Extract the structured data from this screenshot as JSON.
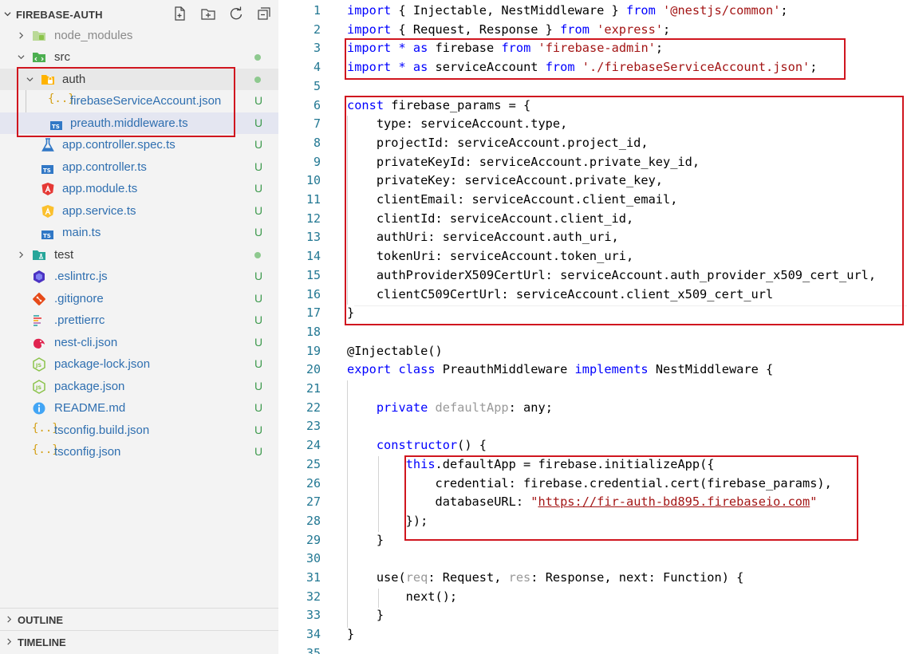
{
  "explorer": {
    "title": "FIREBASE-AUTH",
    "actions": [
      "new-file-icon",
      "new-folder-icon",
      "refresh-icon",
      "collapse-all-icon"
    ],
    "items": [
      {
        "label": "node_modules",
        "depth": 0,
        "kind": "folder",
        "expanded": false,
        "status": "",
        "icon": "node-modules-folder-icon"
      },
      {
        "label": "src",
        "depth": 0,
        "kind": "folder",
        "expanded": true,
        "status": "dot",
        "icon": "src-folder-icon"
      },
      {
        "label": "auth",
        "depth": 1,
        "kind": "folder",
        "expanded": true,
        "status": "dot",
        "icon": "auth-folder-icon"
      },
      {
        "label": "firebaseServiceAccount.json",
        "depth": 2,
        "kind": "file",
        "status": "U",
        "icon": "json-file-icon"
      },
      {
        "label": "preauth.middleware.ts",
        "depth": 2,
        "kind": "file",
        "status": "U",
        "icon": "typescript-file-icon",
        "selected": true
      },
      {
        "label": "app.controller.spec.ts",
        "depth": 1,
        "kind": "file",
        "status": "U",
        "icon": "test-flask-icon"
      },
      {
        "label": "app.controller.ts",
        "depth": 1,
        "kind": "file",
        "status": "U",
        "icon": "typescript-file-icon"
      },
      {
        "label": "app.module.ts",
        "depth": 1,
        "kind": "file",
        "status": "U",
        "icon": "angular-icon"
      },
      {
        "label": "app.service.ts",
        "depth": 1,
        "kind": "file",
        "status": "U",
        "icon": "service-icon"
      },
      {
        "label": "main.ts",
        "depth": 1,
        "kind": "file",
        "status": "U",
        "icon": "typescript-file-icon"
      },
      {
        "label": "test",
        "depth": 0,
        "kind": "folder",
        "expanded": false,
        "status": "dot",
        "icon": "test-folder-icon"
      },
      {
        "label": ".eslintrc.js",
        "depth": 0,
        "kind": "file",
        "status": "U",
        "icon": "eslint-icon"
      },
      {
        "label": ".gitignore",
        "depth": 0,
        "kind": "file",
        "status": "U",
        "icon": "git-icon"
      },
      {
        "label": ".prettierrc",
        "depth": 0,
        "kind": "file",
        "status": "U",
        "icon": "prettier-icon"
      },
      {
        "label": "nest-cli.json",
        "depth": 0,
        "kind": "file",
        "status": "U",
        "icon": "nest-icon"
      },
      {
        "label": "package-lock.json",
        "depth": 0,
        "kind": "file",
        "status": "U",
        "icon": "nodejs-icon"
      },
      {
        "label": "package.json",
        "depth": 0,
        "kind": "file",
        "status": "U",
        "icon": "nodejs-icon"
      },
      {
        "label": "README.md",
        "depth": 0,
        "kind": "file",
        "status": "U",
        "icon": "info-icon"
      },
      {
        "label": "tsconfig.build.json",
        "depth": 0,
        "kind": "file",
        "status": "U",
        "icon": "json-file-icon"
      },
      {
        "label": "tsconfig.json",
        "depth": 0,
        "kind": "file",
        "status": "U",
        "icon": "json-file-icon"
      }
    ],
    "outline_label": "OUTLINE",
    "timeline_label": "TIMELINE"
  },
  "editor": {
    "line_numbers": [
      "1",
      "2",
      "3",
      "4",
      "5",
      "6",
      "7",
      "8",
      "9",
      "10",
      "11",
      "12",
      "13",
      "14",
      "15",
      "16",
      "17",
      "18",
      "19",
      "20",
      "21",
      "22",
      "23",
      "24",
      "25",
      "26",
      "27",
      "28",
      "29",
      "30",
      "31",
      "32",
      "33",
      "34",
      "35"
    ],
    "lines": [
      [
        [
          "kw",
          "import"
        ],
        [
          "plain",
          " { Injectable, NestMiddleware } "
        ],
        [
          "kw",
          "from"
        ],
        [
          "plain",
          " "
        ],
        [
          "str",
          "'@nestjs/common'"
        ],
        [
          "plain",
          ";"
        ]
      ],
      [
        [
          "kw",
          "import"
        ],
        [
          "plain",
          " { Request, Response } "
        ],
        [
          "kw",
          "from"
        ],
        [
          "plain",
          " "
        ],
        [
          "str",
          "'express'"
        ],
        [
          "plain",
          ";"
        ]
      ],
      [
        [
          "kw",
          "import"
        ],
        [
          "plain",
          " "
        ],
        [
          "kw",
          "*"
        ],
        [
          "plain",
          " "
        ],
        [
          "kw",
          "as"
        ],
        [
          "plain",
          " firebase "
        ],
        [
          "kw",
          "from"
        ],
        [
          "plain",
          " "
        ],
        [
          "str",
          "'firebase-admin'"
        ],
        [
          "plain",
          ";"
        ]
      ],
      [
        [
          "kw",
          "import"
        ],
        [
          "plain",
          " "
        ],
        [
          "kw",
          "*"
        ],
        [
          "plain",
          " "
        ],
        [
          "kw",
          "as"
        ],
        [
          "plain",
          " serviceAccount "
        ],
        [
          "kw",
          "from"
        ],
        [
          "plain",
          " "
        ],
        [
          "str",
          "'./firebaseServiceAccount.json'"
        ],
        [
          "plain",
          ";"
        ]
      ],
      [],
      [
        [
          "kw",
          "const"
        ],
        [
          "plain",
          " firebase_params = {"
        ]
      ],
      [
        [
          "plain",
          "    type: serviceAccount.type,"
        ]
      ],
      [
        [
          "plain",
          "    projectId: serviceAccount.project_id,"
        ]
      ],
      [
        [
          "plain",
          "    privateKeyId: serviceAccount.private_key_id,"
        ]
      ],
      [
        [
          "plain",
          "    privateKey: serviceAccount.private_key,"
        ]
      ],
      [
        [
          "plain",
          "    clientEmail: serviceAccount.client_email,"
        ]
      ],
      [
        [
          "plain",
          "    clientId: serviceAccount.client_id,"
        ]
      ],
      [
        [
          "plain",
          "    authUri: serviceAccount.auth_uri,"
        ]
      ],
      [
        [
          "plain",
          "    tokenUri: serviceAccount.token_uri,"
        ]
      ],
      [
        [
          "plain",
          "    authProviderX509CertUrl: serviceAccount.auth_provider_x509_cert_url,"
        ]
      ],
      [
        [
          "plain",
          "    clientC509CertUrl: serviceAccount.client_x509_cert_url"
        ]
      ],
      [
        [
          "plain",
          "}"
        ]
      ],
      [],
      [
        [
          "plain",
          "@Injectable()"
        ]
      ],
      [
        [
          "kw",
          "export"
        ],
        [
          "plain",
          " "
        ],
        [
          "kw",
          "class"
        ],
        [
          "plain",
          " PreauthMiddleware "
        ],
        [
          "kw",
          "implements"
        ],
        [
          "plain",
          " NestMiddleware {"
        ]
      ],
      [],
      [
        [
          "plain",
          "    "
        ],
        [
          "kw",
          "private"
        ],
        [
          "plain",
          " "
        ],
        [
          "dim",
          "defaultApp"
        ],
        [
          "plain",
          ": any;"
        ]
      ],
      [],
      [
        [
          "plain",
          "    "
        ],
        [
          "kw",
          "constructor"
        ],
        [
          "plain",
          "() {"
        ]
      ],
      [
        [
          "plain",
          "        "
        ],
        [
          "kw",
          "this"
        ],
        [
          "plain",
          ".defaultApp = firebase.initializeApp({"
        ]
      ],
      [
        [
          "plain",
          "            credential: firebase.credential.cert(firebase_params),"
        ]
      ],
      [
        [
          "plain",
          "            databaseURL: "
        ],
        [
          "str",
          "\""
        ],
        [
          "link",
          "https://fir-auth-bd895.firebaseio.com"
        ],
        [
          "str",
          "\""
        ]
      ],
      [
        [
          "plain",
          "        });"
        ]
      ],
      [
        [
          "plain",
          "    }"
        ]
      ],
      [],
      [
        [
          "plain",
          "    use("
        ],
        [
          "dim",
          "req"
        ],
        [
          "plain",
          ": Request, "
        ],
        [
          "dim",
          "res"
        ],
        [
          "plain",
          ": Response, next: Function) {"
        ]
      ],
      [
        [
          "plain",
          "        next();"
        ]
      ],
      [
        [
          "plain",
          "    }"
        ]
      ],
      [
        [
          "plain",
          "}"
        ]
      ],
      []
    ]
  },
  "colors": {
    "highlight_box": "#d0161f",
    "keyword": "#0000ff",
    "string": "#a31515",
    "line_number": "#237893",
    "git_untracked": "#3e9a4e",
    "sidebar_bg": "#f3f3f3"
  }
}
